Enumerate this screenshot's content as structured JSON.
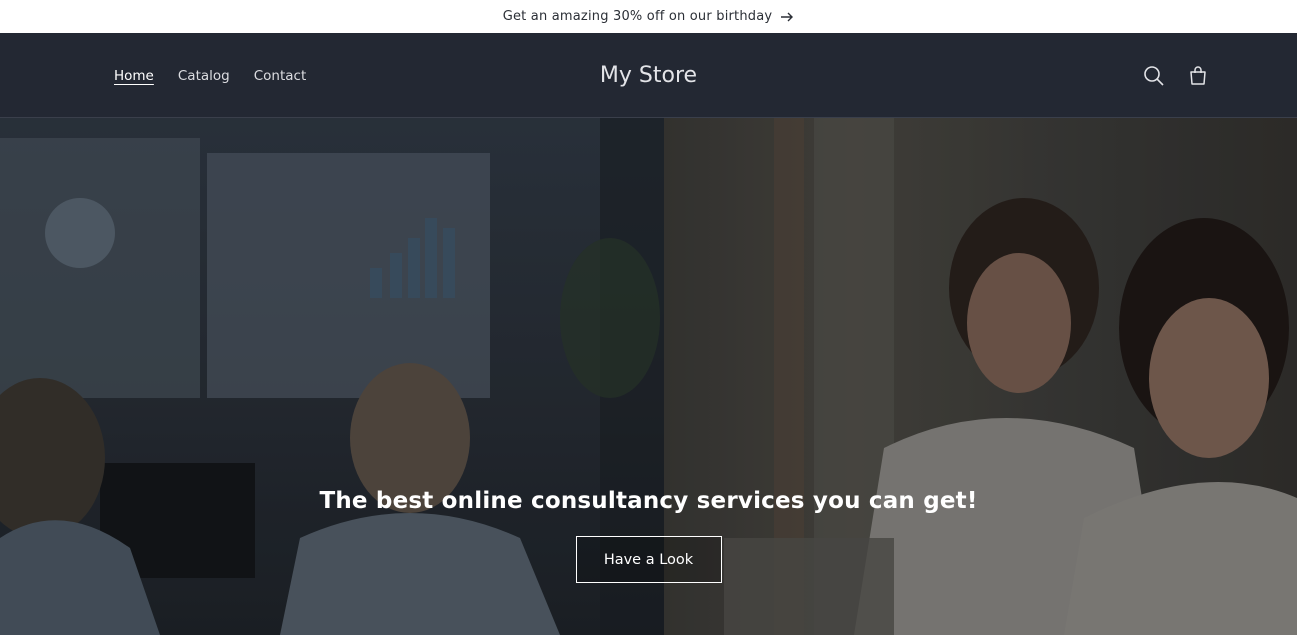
{
  "announcement": {
    "text": "Get an amazing 30% off on our birthday",
    "icon": "arrow-right-icon"
  },
  "header": {
    "nav": [
      {
        "label": "Home",
        "active": true
      },
      {
        "label": "Catalog",
        "active": false
      },
      {
        "label": "Contact",
        "active": false
      }
    ],
    "logo": "My Store",
    "icons": [
      "search-icon",
      "cart-icon"
    ]
  },
  "hero": {
    "title": "The best online consultancy services you can get!",
    "button_label": "Have a Look",
    "left_image": "office-meeting-image",
    "right_image": "doctors-image"
  },
  "colors": {
    "header_bg": "#232833",
    "announcement_bg": "#ffffff",
    "text": "#ffffff"
  }
}
